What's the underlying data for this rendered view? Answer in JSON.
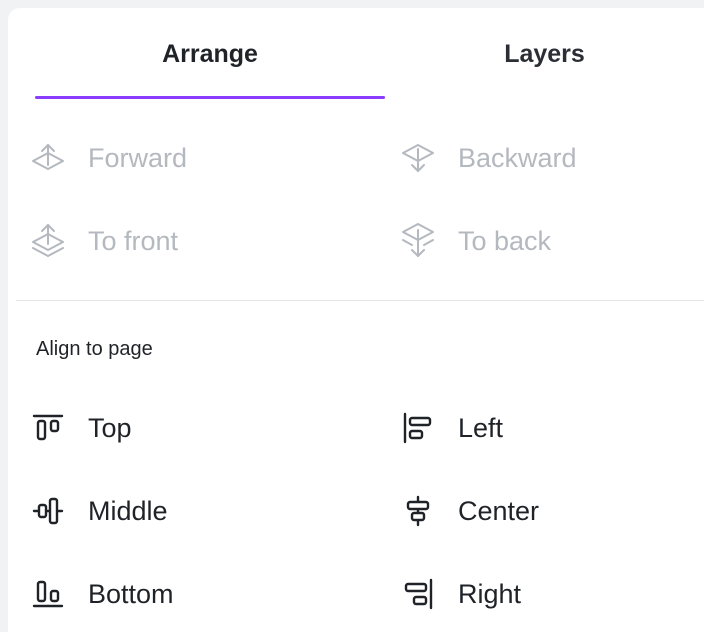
{
  "tabs": {
    "arrange": "Arrange",
    "layers": "Layers"
  },
  "order": {
    "forward": "Forward",
    "backward": "Backward",
    "to_front": "To front",
    "to_back": "To back"
  },
  "align": {
    "title": "Align to page",
    "top": "Top",
    "left": "Left",
    "middle": "Middle",
    "center": "Center",
    "bottom": "Bottom",
    "right": "Right"
  },
  "colors": {
    "accent": "#8b3dff",
    "disabled_text": "#b4b8bf",
    "text": "#1f2328"
  }
}
